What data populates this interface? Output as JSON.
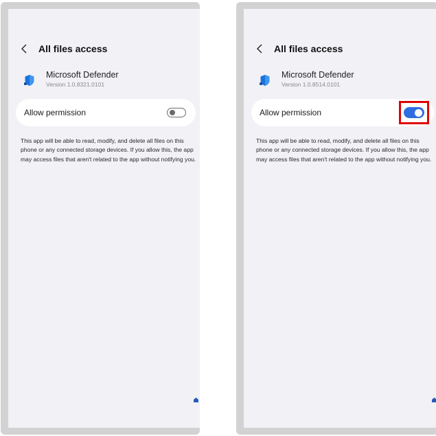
{
  "colors": {
    "frame": "#d2d2d2",
    "screen_bg": "#f1f1f6",
    "card_bg": "#ffffff",
    "toggle_on": "#2f6ee0",
    "toggle_off": "#6b6b6b",
    "highlight": "#e00000",
    "shield_blue": "#1a73d9"
  },
  "icons": {
    "back": "chevron-left-icon",
    "app": "defender-shield-icon",
    "corner": "home-indicator-icon"
  },
  "left_screen": {
    "title": "All files access",
    "app_name": "Microsoft Defender",
    "app_version": "Version 1.0.8321.0101",
    "permission_label": "Allow permission",
    "permission_state": "off",
    "description": "This app will be able to read, modify, and delete all files on this phone or any connected storage devices. If you allow this, the app may access files that aren't related to the app without notifying you."
  },
  "right_screen": {
    "title": "All files access",
    "app_name": "Microsoft Defender",
    "app_version": "Version 1.0.8514.0101",
    "permission_label": "Allow permission",
    "permission_state": "on",
    "toggle_highlighted": true,
    "description": "This app will be able to read, modify, and delete all files on this phone or any connected storage devices. If you allow this, the app may access files that aren't related to the app without notifying you."
  }
}
